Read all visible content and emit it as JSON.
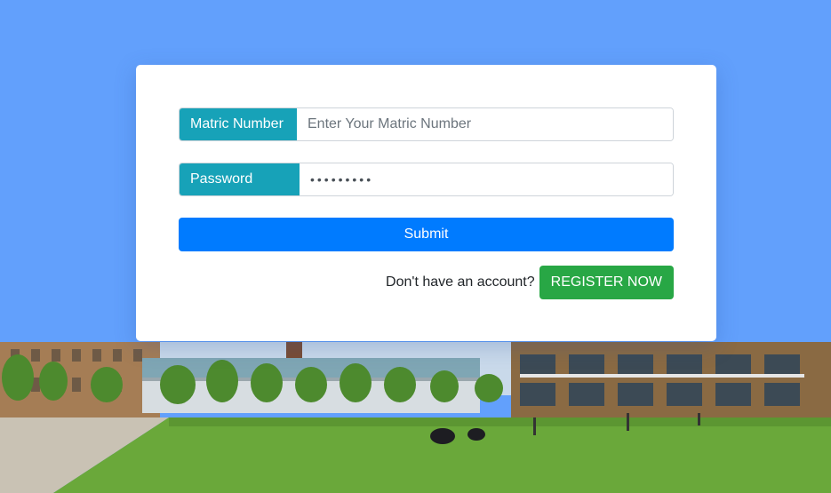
{
  "login_form": {
    "matric_label": "Matric Number",
    "matric_placeholder": "Enter Your Matric Number",
    "matric_value": "",
    "password_label": "Password",
    "password_value": "•••••••••",
    "submit_label": "Submit",
    "register_prompt": "Don't have an account?",
    "register_label": "REGISTER NOW"
  },
  "colors": {
    "page_background": "#62a0fc",
    "addon": "#17a2b8",
    "submit": "#007bff",
    "register": "#28a745"
  },
  "background_image": {
    "scene": "campus-lawn-photo"
  }
}
